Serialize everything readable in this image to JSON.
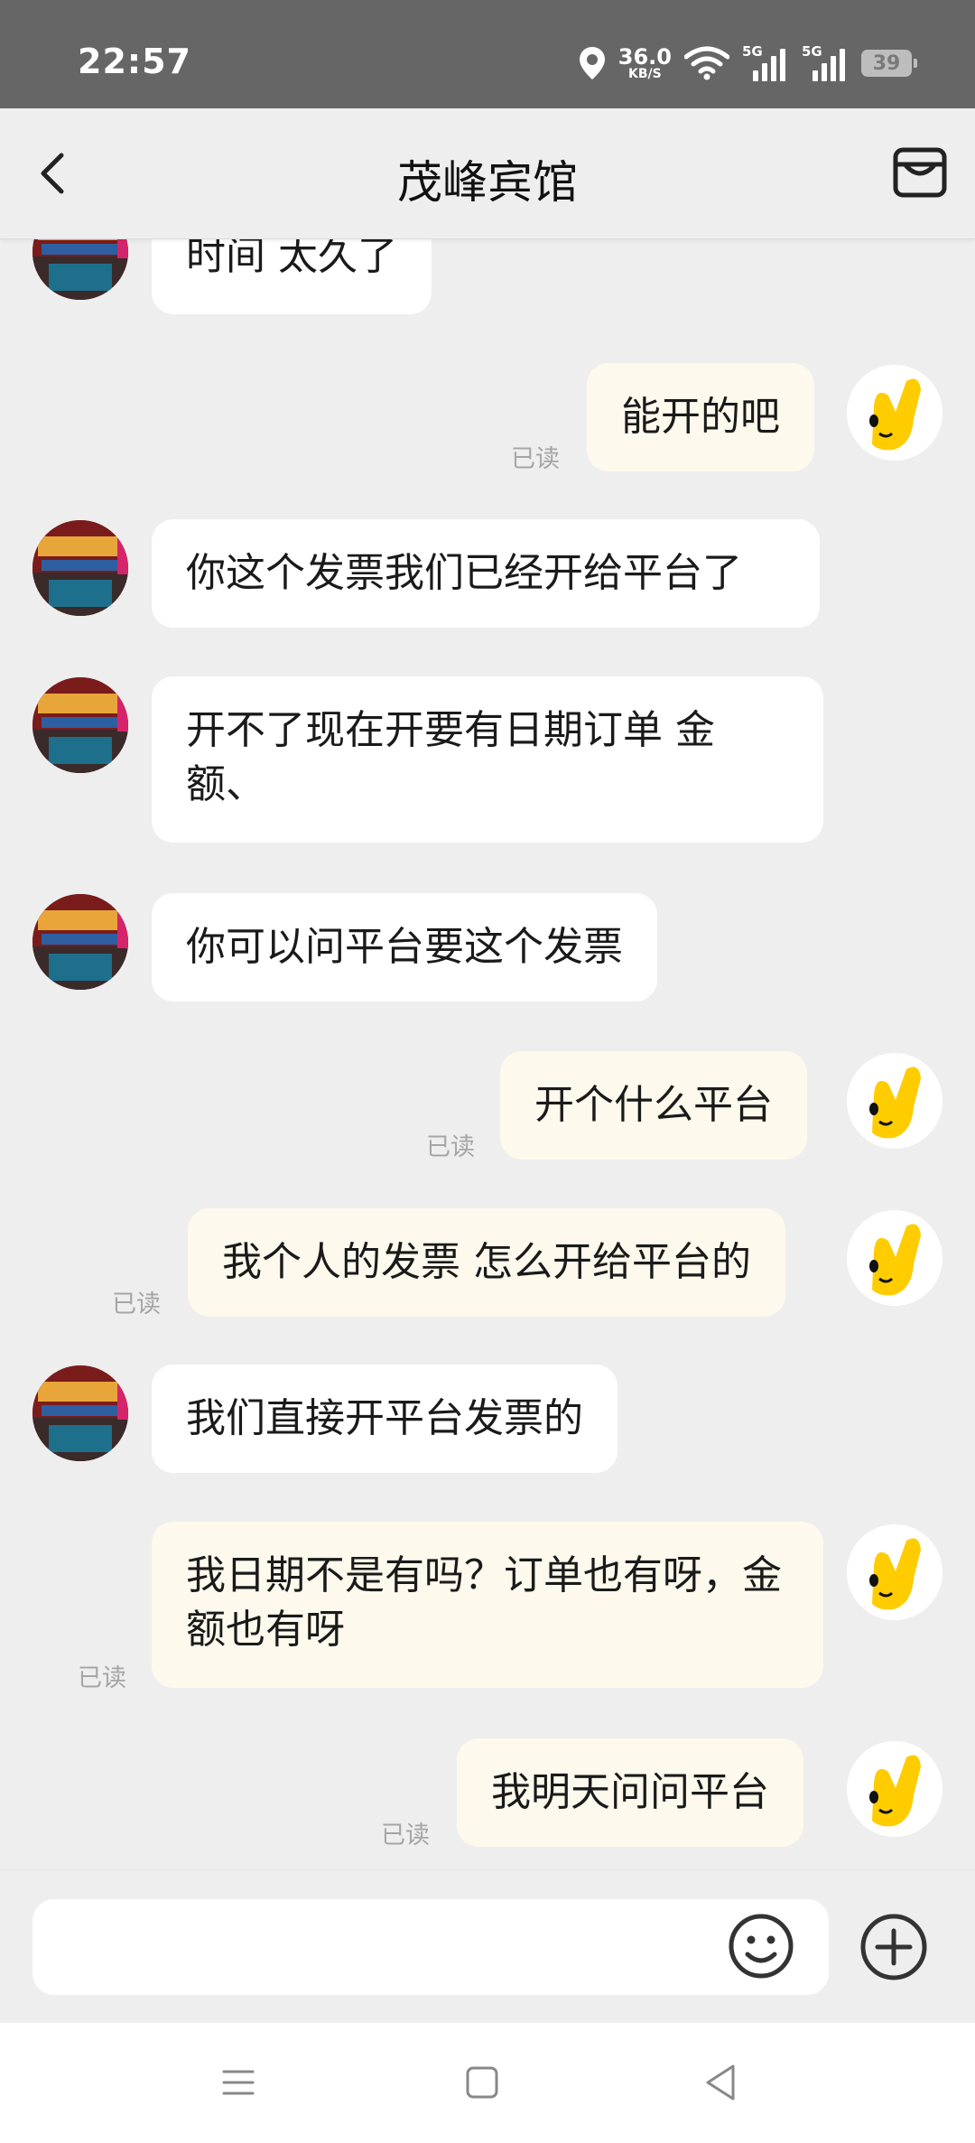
{
  "status_bar": {
    "time": "22:57",
    "net_speed_value": "36.0",
    "net_speed_unit": "KB/S",
    "signal_1_tag": "5G",
    "signal_2_tag": "5G",
    "battery": "39",
    "icons": [
      "location-icon",
      "wifi-icon",
      "signal-icon",
      "signal-icon",
      "battery-icon"
    ]
  },
  "header": {
    "title": "茂峰宾馆",
    "back_icon": "chevron-left-icon",
    "shop_icon": "store-icon"
  },
  "messages": [
    {
      "side": "in",
      "text": "时间 太久了"
    },
    {
      "side": "out",
      "text": "能开的吧",
      "status": "已读"
    },
    {
      "side": "in",
      "text": "你这个发票我们已经开给平台了"
    },
    {
      "side": "in",
      "text": "开不了现在开要有日期订单 金额、"
    },
    {
      "side": "in",
      "text": "你可以问平台要这个发票"
    },
    {
      "side": "out",
      "text": "开个什么平台",
      "status": "已读"
    },
    {
      "side": "out",
      "text": "我个人的发票 怎么开给平台的",
      "status": "已读"
    },
    {
      "side": "in",
      "text": "我们直接开平台发票的"
    },
    {
      "side": "out",
      "text": "我日期不是有吗？订单也有呀，金额也有呀",
      "status": "已读"
    },
    {
      "side": "out",
      "text": "我明天问问平台",
      "status": "已读"
    }
  ],
  "input_bar": {
    "placeholder": "",
    "emoji_icon": "smiley-icon",
    "plus_icon": "plus-circle-icon"
  },
  "nav_bar": {
    "icons": [
      "menu-icon",
      "home-square-icon",
      "back-triangle-icon"
    ]
  }
}
